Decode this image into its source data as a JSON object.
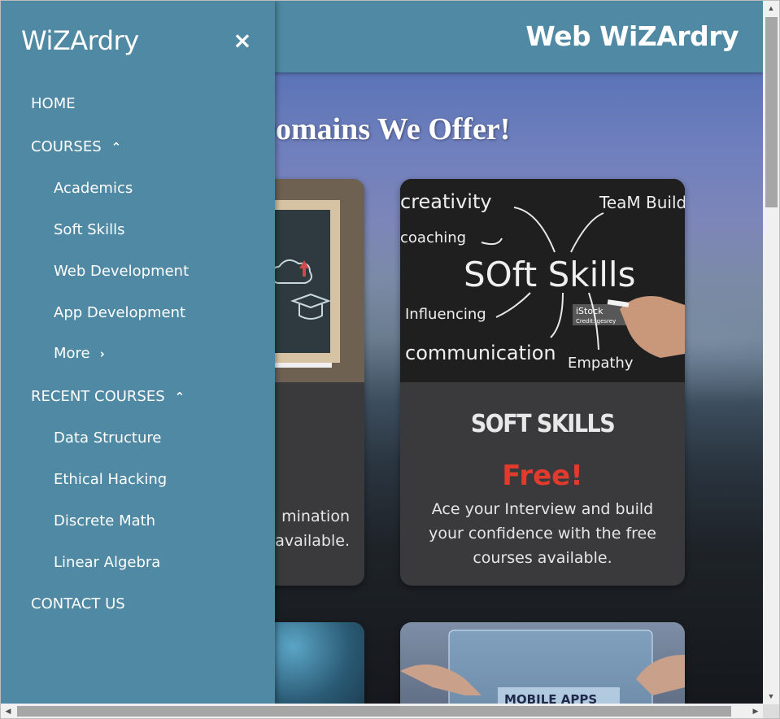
{
  "site": {
    "brand_title": "Web WiZArdry",
    "section_heading": "Domains We Offer!"
  },
  "sidebar": {
    "brand": "WiZArdry",
    "close_icon": "×",
    "items": [
      {
        "label": "HOME",
        "level": "top"
      },
      {
        "label": "COURSES",
        "level": "top",
        "chevron": "up"
      },
      {
        "label": "Academics",
        "level": "sub"
      },
      {
        "label": "Soft Skills",
        "level": "sub"
      },
      {
        "label": "Web Development",
        "level": "sub"
      },
      {
        "label": "App Development",
        "level": "sub"
      },
      {
        "label": "More",
        "level": "sub",
        "chevron": "right"
      },
      {
        "label": "RECENT COURSES",
        "level": "top",
        "chevron": "up"
      },
      {
        "label": "Data Structure",
        "level": "sub"
      },
      {
        "label": "Ethical Hacking",
        "level": "sub"
      },
      {
        "label": "Discrete Math",
        "level": "sub"
      },
      {
        "label": "Linear Algebra",
        "level": "sub"
      },
      {
        "label": "CONTACT US",
        "level": "top"
      }
    ]
  },
  "cards": {
    "academics": {
      "desc_line1": "mination",
      "desc_line2": "available."
    },
    "softskills": {
      "title": "SOFT SKILLS",
      "price": "Free!",
      "desc": "Ace your Interview and build your confidence with the free courses available.",
      "image_words": {
        "center": "SOft Skills",
        "w1": "creativity",
        "w2": "coaching",
        "w3": "TeaM Building",
        "w4": "Influencing",
        "w5": "communication",
        "w6": "Empathy",
        "stock": "iStock",
        "credit": "Credit: gesrey"
      }
    },
    "app": {
      "image_text": "MOBILE APPS"
    }
  },
  "colors": {
    "sidebar_bg": "#4f89a3",
    "topbar_bg": "#4f89a3",
    "card_bg": "#3a3a3c",
    "price_red": "#e23b2e"
  }
}
